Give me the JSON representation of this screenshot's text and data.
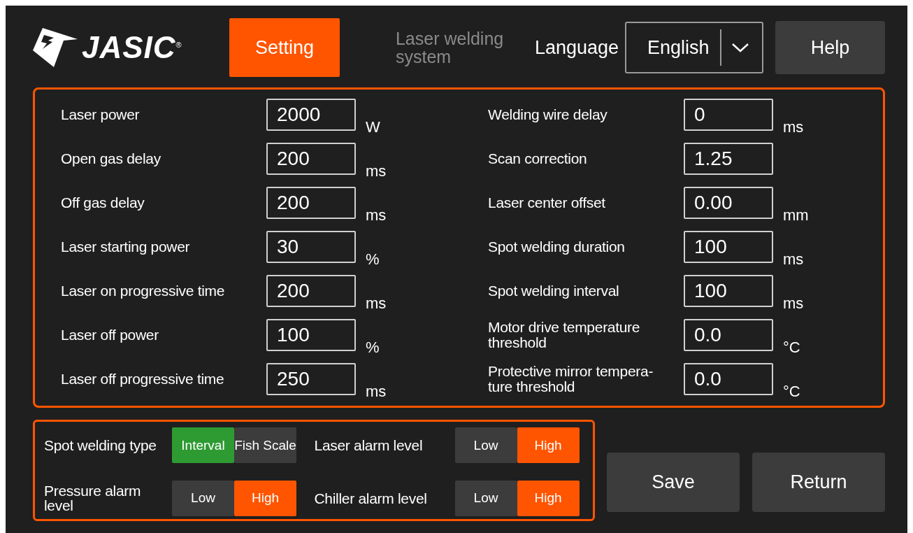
{
  "header": {
    "logo": {
      "text": "JASIC",
      "mark": "®"
    },
    "tab": {
      "label": "Setting",
      "selected": true
    },
    "title": "Laser welding\nsystem",
    "language_label": "Language",
    "language": {
      "value": "English"
    },
    "help": "Help"
  },
  "parameters": {
    "columns": [
      [
        {
          "label": "Laser power",
          "value": "2000",
          "unit": "W"
        },
        {
          "label": "Open gas delay",
          "value": "200",
          "unit": "ms"
        },
        {
          "label": "Off gas delay",
          "value": "200",
          "unit": "ms"
        },
        {
          "label": "Laser starting power",
          "value": "30",
          "unit": "%"
        },
        {
          "label": "Laser on progressive time",
          "value": "200",
          "unit": "ms"
        },
        {
          "label": "Laser off power",
          "value": "100",
          "unit": "%"
        },
        {
          "label": "Laser off progressive time",
          "value": "250",
          "unit": "ms"
        }
      ],
      [
        {
          "label": "Welding wire delay",
          "value": "0",
          "unit": "ms"
        },
        {
          "label": "Scan correction",
          "value": "1.25"
        },
        {
          "label": "Laser center offset",
          "value": "0.00",
          "unit": "mm"
        },
        {
          "label": "Spot welding duration",
          "value": "100",
          "unit": "ms"
        },
        {
          "label": "Spot welding interval",
          "value": "100",
          "unit": "ms"
        },
        {
          "label": "Motor drive temperature\nthreshold",
          "value": "0.0",
          "unit": "°C"
        },
        {
          "label": "Protective mirror tempera-\nture threshold",
          "value": "0.0",
          "unit": "°C"
        }
      ]
    ]
  },
  "switches": [
    {
      "label": "Spot welding type",
      "kind": "mode",
      "options": [
        {
          "label": "Interval",
          "selected": true
        },
        {
          "label": "Fish Scale",
          "selected": false
        }
      ]
    },
    {
      "label": "Laser alarm level",
      "kind": "alarm",
      "options": [
        {
          "label": "Low",
          "selected": false
        },
        {
          "label": "High",
          "selected": true
        }
      ]
    },
    {
      "label": "Pressure alarm\nlevel",
      "kind": "alarm",
      "options": [
        {
          "label": "Low",
          "selected": false
        },
        {
          "label": "High",
          "selected": true
        }
      ]
    },
    {
      "label": "Chiller alarm level",
      "kind": "alarm",
      "options": [
        {
          "label": "Low",
          "selected": false
        },
        {
          "label": "High",
          "selected": true
        }
      ]
    }
  ],
  "buttons": [
    "Save",
    "Return"
  ]
}
